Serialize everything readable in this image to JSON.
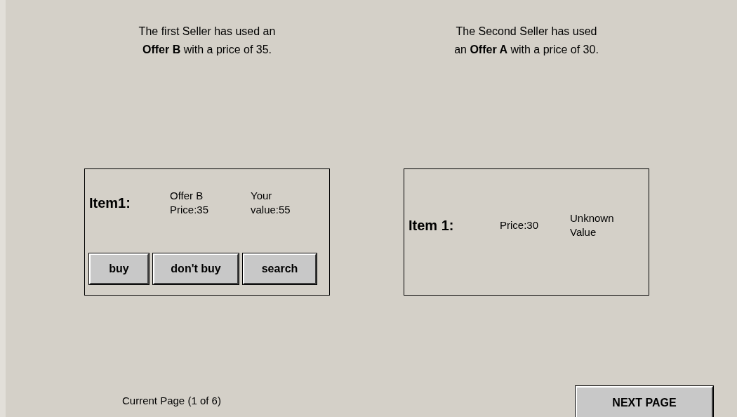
{
  "sellers": [
    {
      "message": "The first Seller has used an\n**Offer B**  with a price of 35.",
      "item": {
        "label": "Item1:",
        "offer": "Offer B\nPrice:35",
        "value": "Your\nvalue:55"
      },
      "buttons": [
        "buy",
        "don't buy",
        "search"
      ]
    },
    {
      "message": "The Second Seller has used\nan **Offer A**  with a price of 30.",
      "item": {
        "label": "Item 1:",
        "offer": "Price:30",
        "value": "Unknown\nValue"
      }
    }
  ],
  "page_indicator": "Current Page (1 of 6)",
  "next_button": "NEXT PAGE"
}
